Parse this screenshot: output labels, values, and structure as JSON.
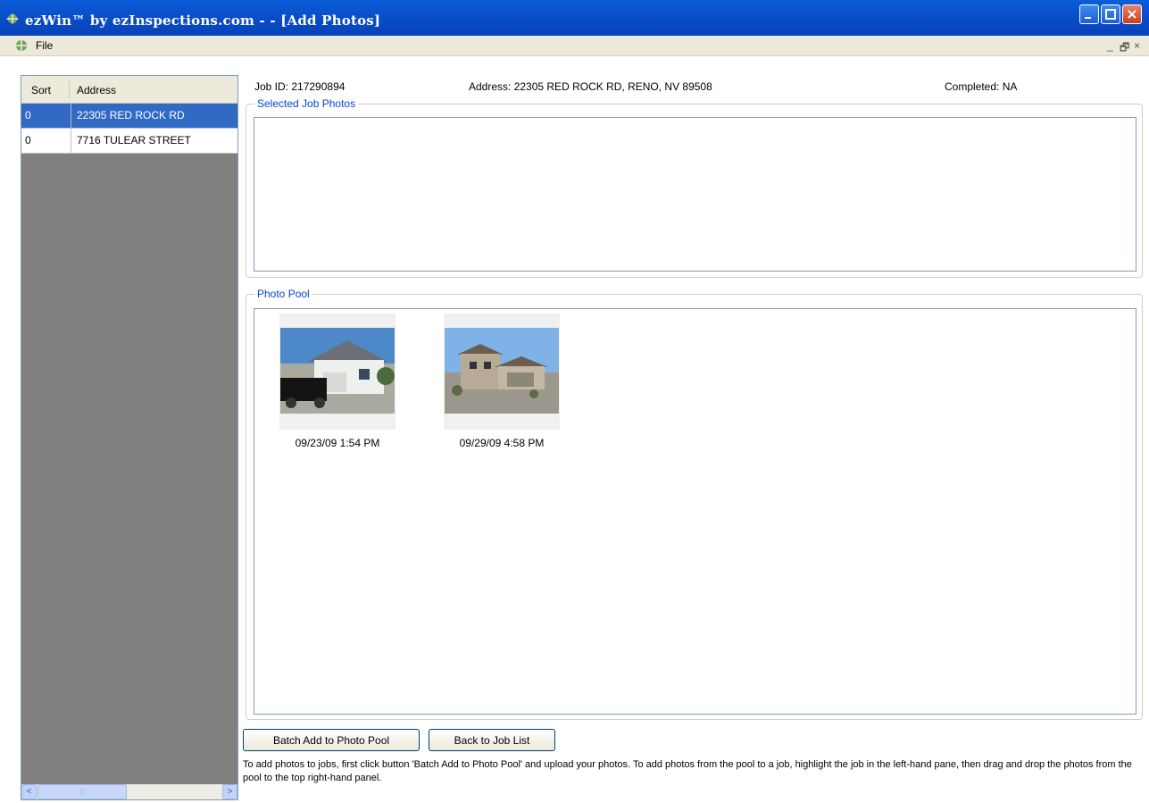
{
  "window": {
    "title": "ezWin™ by ezInspections.com - - [Add Photos]"
  },
  "menu": {
    "file_label": "File",
    "mdi_min": "_",
    "mdi_restore": "🗗",
    "mdi_close": "×"
  },
  "job_list": {
    "headers": {
      "sort": "Sort",
      "address": "Address"
    },
    "rows": [
      {
        "sort": "0",
        "address": "22305 RED ROCK RD",
        "selected": true
      },
      {
        "sort": "0",
        "address": "7716 TULEAR STREET",
        "selected": false
      }
    ],
    "scroll_left": "<",
    "scroll_thumb": "|||",
    "scroll_right": ">"
  },
  "job_info": {
    "job_id": "Job ID: 217290894",
    "address": "Address: 22305 RED ROCK RD, RENO, NV 89508",
    "completed": "Completed: NA"
  },
  "selected_photos": {
    "legend": "Selected Job Photos"
  },
  "photo_pool": {
    "legend": "Photo Pool",
    "photos": [
      {
        "caption": "09/23/09 1:54 PM"
      },
      {
        "caption": "09/29/09 4:58 PM"
      }
    ]
  },
  "buttons": {
    "batch_add": "Batch Add to Photo Pool",
    "back_to_job_list": "Back to Job List"
  },
  "help_text": "To add photos to jobs, first click button 'Batch Add to Photo Pool' and upload your photos. To add photos from the pool to a job, highlight the job in the left-hand pane, then drag and drop the photos from the pool to the top right-hand panel.",
  "colors": {
    "titlebar": "#0a4fcc",
    "selection": "#316ac5",
    "legend_text": "#0046d5",
    "left_pane_bg": "#808080"
  }
}
